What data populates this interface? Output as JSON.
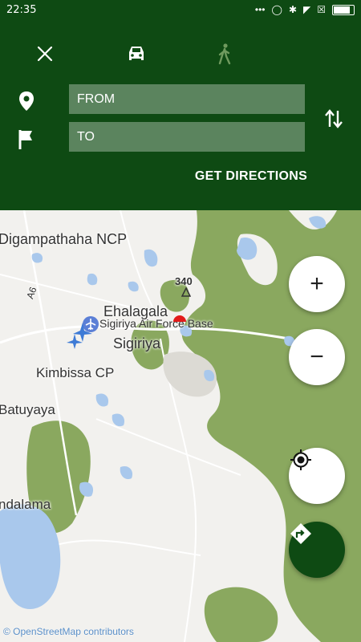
{
  "status_bar": {
    "time": "22:35"
  },
  "header": {
    "from_placeholder": "FROM",
    "to_placeholder": "TO",
    "get_directions_label": "GET DIRECTIONS"
  },
  "map": {
    "places": {
      "digampathaha": "Digampathaha NCP",
      "ehalagala": "Ehalagala",
      "air_force_base": "Sigiriya Air Force Base",
      "sigiriya": "Sigiriya",
      "kimbissa": "Kimbissa CP",
      "batuyaya": "Batuyaya",
      "ndalama": "ndalama"
    },
    "elevation": "340",
    "road": "A6",
    "attribution": "© OpenStreetMap contributors"
  },
  "controls": {
    "zoom_in": "+",
    "zoom_out": "−"
  },
  "colors": {
    "header": "#0e4a13",
    "forest": "#8aa85f",
    "water": "#a9c8ec",
    "land": "#f2f1ee"
  }
}
